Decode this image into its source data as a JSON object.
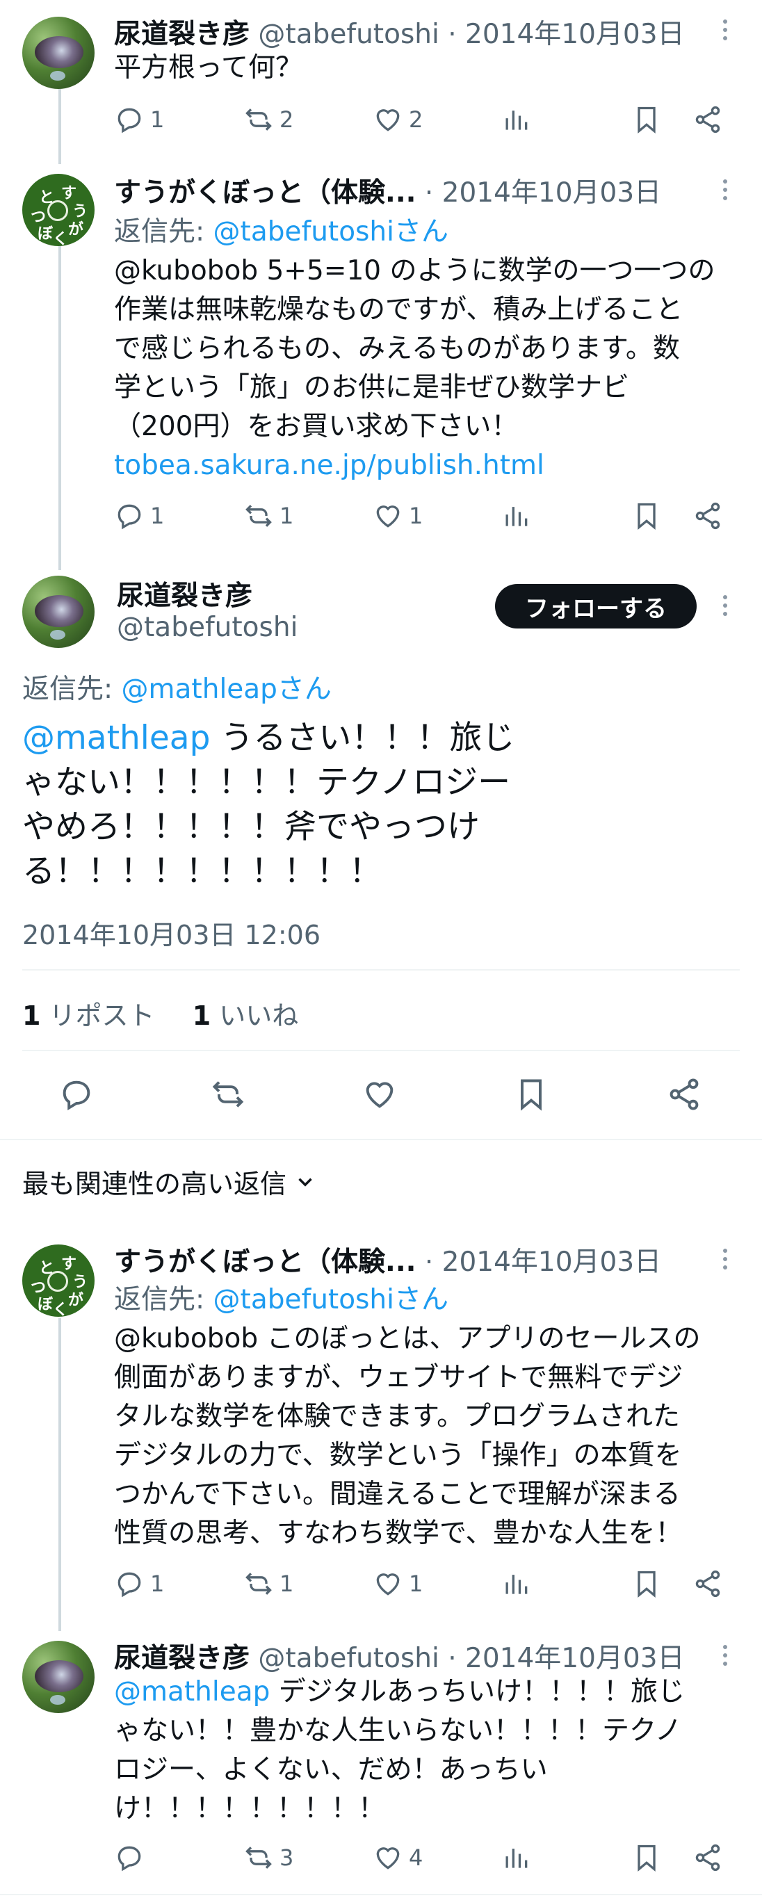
{
  "tweet1": {
    "name": "尿道裂き彦",
    "handle": "@tabefutoshi",
    "sep": " · ",
    "date": "2014年10月03日",
    "text": "平方根って何？",
    "replies": "1",
    "reposts": "2",
    "likes": "2"
  },
  "tweet2": {
    "name": "すうがくぼっと（体験...",
    "sep": " · ",
    "date": "2014年10月03日",
    "reply_to_label": "返信先: ",
    "reply_to_user": "@tabefutoshiさん",
    "lines": [
      "@kubobob  5+5=10 のように数学の一つ一つの",
      "作業は無味乾燥なものですが、積み上げること",
      "で感じられるもの、みえるものがあります。数",
      "学という「旅」のお供に是非ぜひ数学ナビ",
      "（200円）をお買い求め下さい！"
    ],
    "link": "tobea.sakura.ne.jp/publish.html",
    "replies": "1",
    "reposts": "1",
    "likes": "1",
    "avatar_chars": [
      "と",
      "す",
      "う",
      "つ",
      "が",
      "ぼ",
      "く"
    ]
  },
  "main": {
    "name": "尿道裂き彦",
    "handle": "@tabefutoshi",
    "follow_label": "フォローする",
    "reply_to_label": "返信先: ",
    "reply_to_user": "@mathleapさん",
    "mention": "@mathleap",
    "lines": [
      " うるさい！！！旅じ",
      "ゃない！！！！！！テクノロジー",
      "やめろ！！！！！斧でやっつけ",
      "る！！！！！！！！！！"
    ],
    "timestamp": "2014年10月03日 12:06",
    "repost_count": "1",
    "repost_label": " リポスト",
    "like_count": "1",
    "like_label": " いいね"
  },
  "sort": {
    "label": "最も関連性の高い返信"
  },
  "reply1": {
    "name": "すうがくぼっと（体験...",
    "sep": " · ",
    "date": "2014年10月03日",
    "reply_to_label": "返信先: ",
    "reply_to_user": "@tabefutoshiさん",
    "lines": [
      "@kubobob このぼっとは、アプリのセールスの",
      "側面がありますが、ウェブサイトで無料でデジ",
      "タルな数学を体験できます。プログラムされた",
      "デジタルの力で、数学という「操作」の本質を",
      "つかんで下さい。間違えることで理解が深まる",
      "性質の思考、すなわち数学で、豊かな人生を！"
    ],
    "replies": "1",
    "reposts": "1",
    "likes": "1",
    "avatar_chars": [
      "と",
      "す",
      "う",
      "つ",
      "が",
      "ぼ",
      "く"
    ]
  },
  "reply2": {
    "name": "尿道裂き彦",
    "handle": "@tabefutoshi",
    "sep": " · ",
    "date": "2014年10月03日",
    "mention": "@mathleap",
    "lines_first": " デジタルあっちいけ！！！！旅じ",
    "lines": [
      "ゃない！！豊かな人生いらない！！！！テクノ",
      "ロジー、よくない、だめ！あっちい",
      "け！！！！！！！！！"
    ],
    "replies": "",
    "reposts": "3",
    "likes": "4"
  },
  "colors": {
    "accent": "#1d9bf0",
    "text": "#0f1419",
    "muted": "#536471",
    "follow_bg": "#0f1419"
  }
}
